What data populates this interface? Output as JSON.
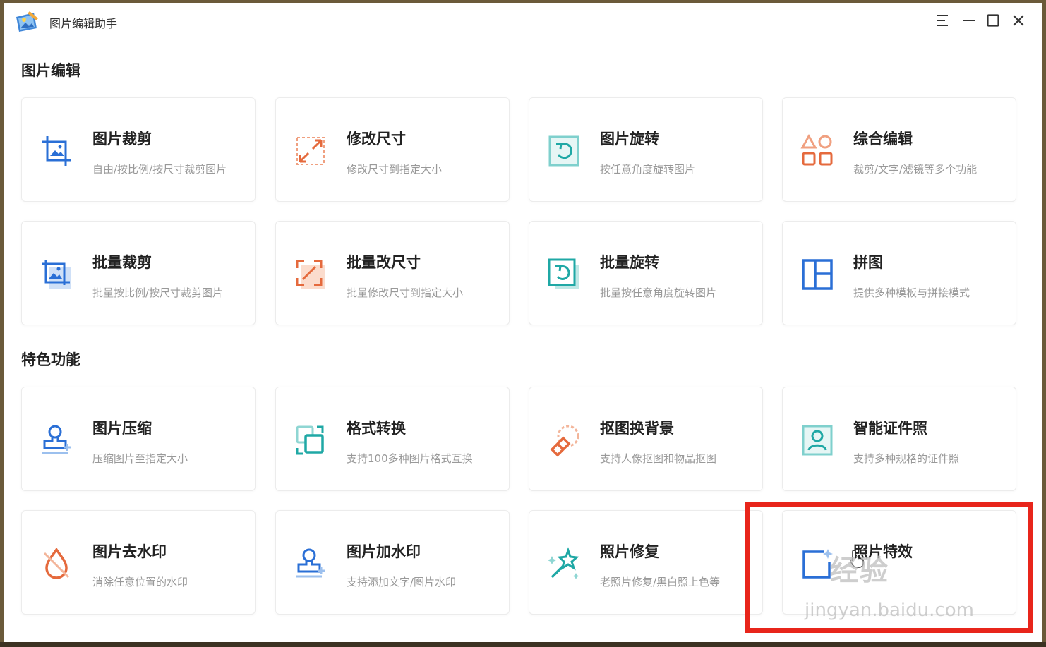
{
  "window": {
    "title": "图片编辑助手",
    "controls": [
      "menu-icon",
      "minimize-icon",
      "maximize-icon",
      "close-icon"
    ]
  },
  "sections": {
    "edit": {
      "title": "图片编辑",
      "cards": [
        {
          "name": "图片裁剪",
          "desc": "自由/按比例/按尺寸裁剪图片",
          "icon": "crop-icon",
          "color": "#2a6fd6"
        },
        {
          "name": "修改尺寸",
          "desc": "修改尺寸到指定大小",
          "icon": "resize-icon",
          "color": "#e56a3d"
        },
        {
          "name": "图片旋转",
          "desc": "按任意角度旋转图片",
          "icon": "rotate-icon",
          "color": "#1fa8a5"
        },
        {
          "name": "综合编辑",
          "desc": "裁剪/文字/滤镜等多个功能",
          "icon": "shapes-icon",
          "color": "#e56a3d"
        },
        {
          "name": "批量裁剪",
          "desc": "批量按比例/按尺寸裁剪图片",
          "icon": "batch-crop-icon",
          "color": "#2a6fd6"
        },
        {
          "name": "批量改尺寸",
          "desc": "批量修改尺寸到指定大小",
          "icon": "batch-resize-icon",
          "color": "#e56a3d"
        },
        {
          "name": "批量旋转",
          "desc": "批量按任意角度旋转图片",
          "icon": "batch-rotate-icon",
          "color": "#1fa8a5"
        },
        {
          "name": "拼图",
          "desc": "提供多种模板与拼接模式",
          "icon": "collage-icon",
          "color": "#2a6fd6"
        }
      ]
    },
    "features": {
      "title": "特色功能",
      "cards": [
        {
          "name": "图片压缩",
          "desc": "压缩图片至指定大小",
          "icon": "compress-stamp-icon",
          "color": "#2a6fd6"
        },
        {
          "name": "格式转换",
          "desc": "支持100多种图片格式互换",
          "icon": "convert-icon",
          "color": "#1fa8a5"
        },
        {
          "name": "抠图换背景",
          "desc": "支持人像抠图和物品抠图",
          "icon": "eraser-icon",
          "color": "#e56a3d"
        },
        {
          "name": "智能证件照",
          "desc": "支持多种规格的证件照",
          "icon": "id-photo-icon",
          "color": "#1fa8a5"
        },
        {
          "name": "图片去水印",
          "desc": "消除任意位置的水印",
          "icon": "remove-watermark-icon",
          "color": "#e56a3d"
        },
        {
          "name": "图片加水印",
          "desc": "支持添加文字/图片水印",
          "icon": "add-watermark-icon",
          "color": "#2a6fd6"
        },
        {
          "name": "照片修复",
          "desc": "老照片修复/黑白照上色等",
          "icon": "magic-wand-icon",
          "color": "#1fa8a5"
        },
        {
          "name": "照片特效",
          "desc": "",
          "icon": "photo-effect-icon",
          "color": "#2a6fd6"
        }
      ]
    }
  },
  "watermark": {
    "top": "经验",
    "bottom": "jingyan.baidu.com"
  },
  "colors": {
    "highlight": "#e8251b",
    "blue": "#2a6fd6",
    "orange": "#e56a3d",
    "teal": "#1fa8a5"
  }
}
